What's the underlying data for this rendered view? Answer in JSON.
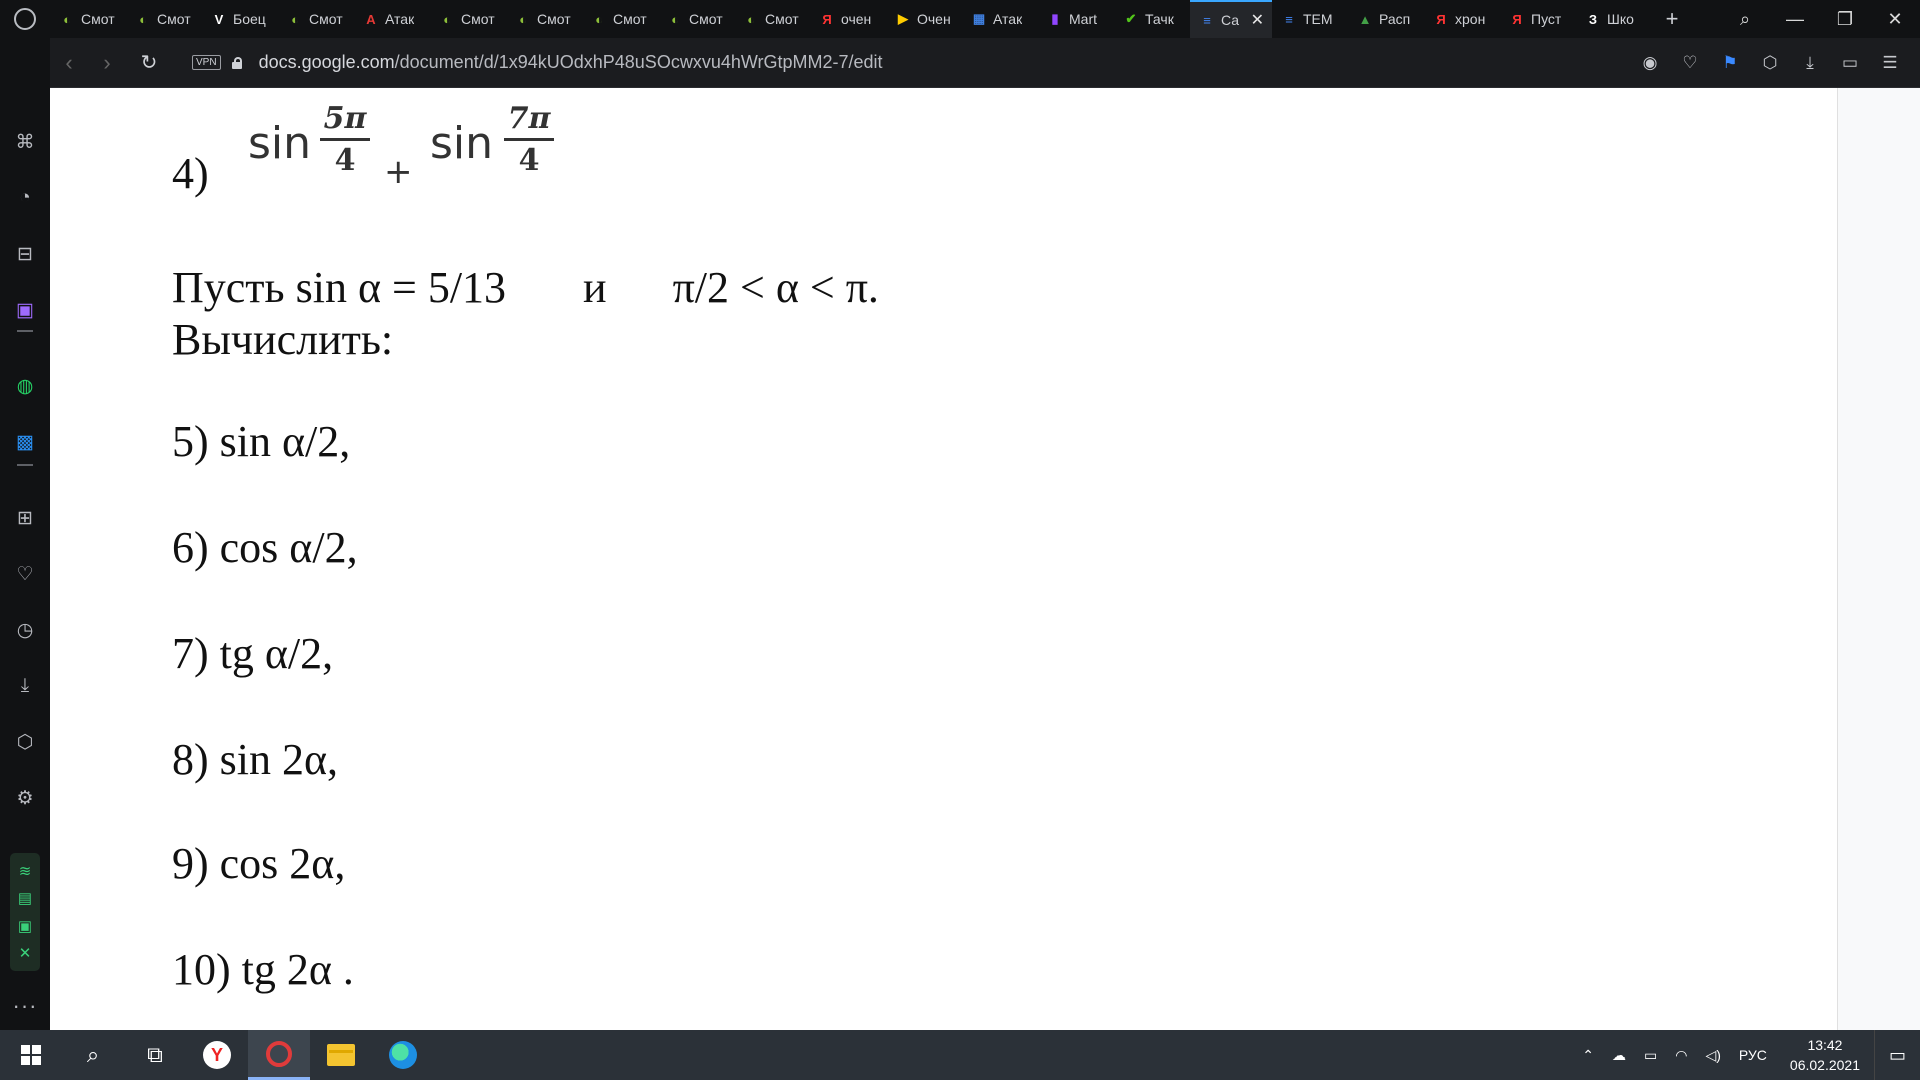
{
  "tabs": [
    {
      "label": "Смот",
      "fav": "◐",
      "fav_color": "#8dbf3a"
    },
    {
      "label": "Смот",
      "fav": "◐",
      "fav_color": "#8dbf3a"
    },
    {
      "label": "Боец",
      "fav": "V",
      "fav_color": "#ffffff"
    },
    {
      "label": "Смот",
      "fav": "◐",
      "fav_color": "#8dbf3a"
    },
    {
      "label": "Атак",
      "fav": "A",
      "fav_color": "#e53935"
    },
    {
      "label": "Смот",
      "fav": "◐",
      "fav_color": "#8dbf3a"
    },
    {
      "label": "Смот",
      "fav": "◐",
      "fav_color": "#8dbf3a"
    },
    {
      "label": "Смот",
      "fav": "◐",
      "fav_color": "#8dbf3a"
    },
    {
      "label": "Смот",
      "fav": "◐",
      "fav_color": "#8dbf3a"
    },
    {
      "label": "Смот",
      "fav": "◐",
      "fav_color": "#8dbf3a"
    },
    {
      "label": "очен",
      "fav": "Я",
      "fav_color": "#ff3333"
    },
    {
      "label": "Очен",
      "fav": "▶",
      "fav_color": "#ffcc00"
    },
    {
      "label": "Атак",
      "fav": "▦",
      "fav_color": "#3f7fe0"
    },
    {
      "label": "Mart",
      "fav": "▮",
      "fav_color": "#9146ff"
    },
    {
      "label": "Тачк",
      "fav": "✔",
      "fav_color": "#52c41a"
    },
    {
      "label": "Са",
      "fav": "≡",
      "fav_color": "#4285f4",
      "active": true
    },
    {
      "label": "TEM",
      "fav": "≡",
      "fav_color": "#4285f4"
    },
    {
      "label": "Расп",
      "fav": "▲",
      "fav_color": "#43a047"
    },
    {
      "label": "хрон",
      "fav": "Я",
      "fav_color": "#ff3333"
    },
    {
      "label": "Пуст",
      "fav": "Я",
      "fav_color": "#ff3333"
    },
    {
      "label": "Шко",
      "fav": "З",
      "fav_color": "#ffffff"
    }
  ],
  "tab_close_glyph": "✕",
  "new_tab_glyph": "+",
  "window": {
    "search": "⌕",
    "minimize": "—",
    "restore": "❐",
    "close": "✕"
  },
  "address": {
    "vpn": "VPN",
    "domain": "docs.google.com",
    "path": "/document/d/1x94kUOdxhP48uSOcwxvu4hWrGtpMM2-7/edit"
  },
  "nav": {
    "back": "‹",
    "forward": "›",
    "reload": "↻"
  },
  "addr_tools": [
    "◉",
    "♡",
    "⚑",
    "⬡",
    "⤓",
    "▭",
    "☰"
  ],
  "sidebar": [
    {
      "name": "games-icon",
      "glyph": "⌘"
    },
    {
      "name": "speed-dial-icon",
      "glyph": "◔"
    },
    {
      "name": "bag-icon",
      "glyph": "⊟"
    },
    {
      "name": "twitch-icon",
      "glyph": "▣",
      "cls": "tw"
    },
    {
      "name": "whatsapp-icon",
      "glyph": "◍",
      "cls": "wa"
    },
    {
      "name": "vk-icon",
      "glyph": "▩",
      "cls": "vk"
    },
    {
      "name": "apps-icon",
      "glyph": "⊞"
    },
    {
      "name": "heart-icon",
      "glyph": "♡"
    },
    {
      "name": "history-icon",
      "glyph": "◷"
    },
    {
      "name": "download-icon",
      "glyph": "⤓"
    },
    {
      "name": "cube-icon",
      "glyph": "⬡"
    },
    {
      "name": "settings-icon",
      "glyph": "⚙"
    }
  ],
  "sidebar_widget": [
    "≋",
    "▤",
    "▣",
    "✕"
  ],
  "sidebar_more": "···",
  "doc": {
    "item4_label": "4)",
    "sin": "sin",
    "frac1_num": "5π",
    "frac1_den": "4",
    "plus": "+",
    "frac2_num": "7π",
    "frac2_den": "4",
    "given_line": "Пусть sin α = 5/13       и      π/2 < α < π.",
    "compute": "Вычислить:",
    "items": [
      "5) sin α/2,",
      "6) cos α/2,",
      "7) tg α/2,",
      "8) sin 2α,",
      "9) cos 2α,",
      "10) tg 2α ."
    ]
  },
  "taskbar": {
    "lang": "РУС",
    "time": "13:42",
    "date": "06.02.2021",
    "tray_glyphs": [
      "⌃",
      "☁",
      "▭",
      "◠",
      "◁)"
    ]
  }
}
